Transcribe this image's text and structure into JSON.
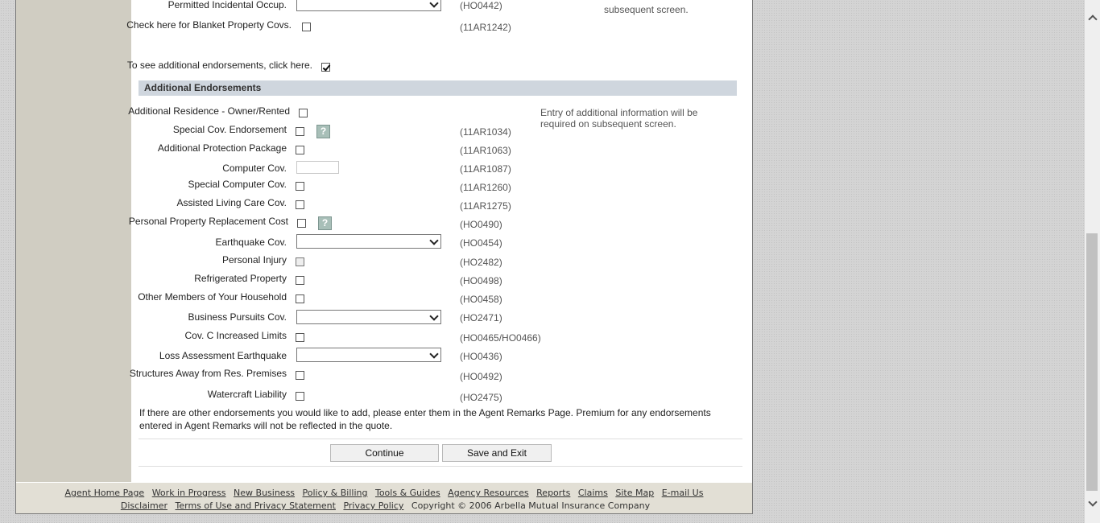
{
  "top_rows": [
    {
      "label": "Permitted Incidental Occup.",
      "code": "(HO0442)"
    },
    {
      "label": "Check here for Blanket Property Covs.",
      "code": "(11AR1242)"
    }
  ],
  "top_note_tail": "subsequent screen.",
  "see_more_label": "To see additional endorsements, click here.",
  "section_title": "Additional Endorsements",
  "section_note": "Entry of additional information will be required on subsequent screen.",
  "rows": [
    {
      "label": "Additional Residence - Owner/Rented",
      "code": ""
    },
    {
      "label": "Special Cov. Endorsement",
      "code": "(11AR1034)"
    },
    {
      "label": "Additional Protection Package",
      "code": "(11AR1063)"
    },
    {
      "label": "Computer Cov.",
      "code": "(11AR1087)",
      "value": ""
    },
    {
      "label": "Special Computer Cov.",
      "code": "(11AR1260)"
    },
    {
      "label": "Assisted Living Care Cov.",
      "code": "(11AR1275)"
    },
    {
      "label": "Personal Property Replacement Cost",
      "code": "(HO0490)"
    },
    {
      "label": "Earthquake Cov.",
      "code": "(HO0454)",
      "value": ""
    },
    {
      "label": "Personal Injury",
      "code": "(HO2482)"
    },
    {
      "label": "Refrigerated Property",
      "code": "(HO0498)"
    },
    {
      "label": "Other Members of Your Household",
      "code": "(HO0458)"
    },
    {
      "label": "Business Pursuits Cov.",
      "code": "(HO2471)",
      "value": ""
    },
    {
      "label": "Cov. C Increased Limits",
      "code": "(HO0465/HO0466)"
    },
    {
      "label": "Loss Assessment Earthquake",
      "code": "(HO0436)",
      "value": ""
    },
    {
      "label": "Structures Away from Res. Premises",
      "code": "(HO0492)"
    },
    {
      "label": "Watercraft Liability",
      "code": "(HO2475)"
    }
  ],
  "help_glyph": "?",
  "remarks_text": "If there are other endorsements you would like to add, please enter them in the Agent Remarks Page. Premium for any endorsements entered in Agent Remarks will not be reflected in the quote.",
  "buttons": {
    "continue": "Continue",
    "save_exit": "Save and Exit"
  },
  "footer": {
    "links_line1": [
      "Agent Home Page",
      "Work in Progress",
      "New Business",
      "Policy & Billing",
      "Tools & Guides",
      "Agency Resources",
      "Reports",
      "Claims",
      "Site Map",
      "E-mail Us"
    ],
    "links_line2": [
      "Disclaimer",
      "Terms of Use and Privacy Statement",
      "Privacy Policy"
    ],
    "copyright": "Copyright © 2006 Arbella Mutual Insurance Company"
  }
}
